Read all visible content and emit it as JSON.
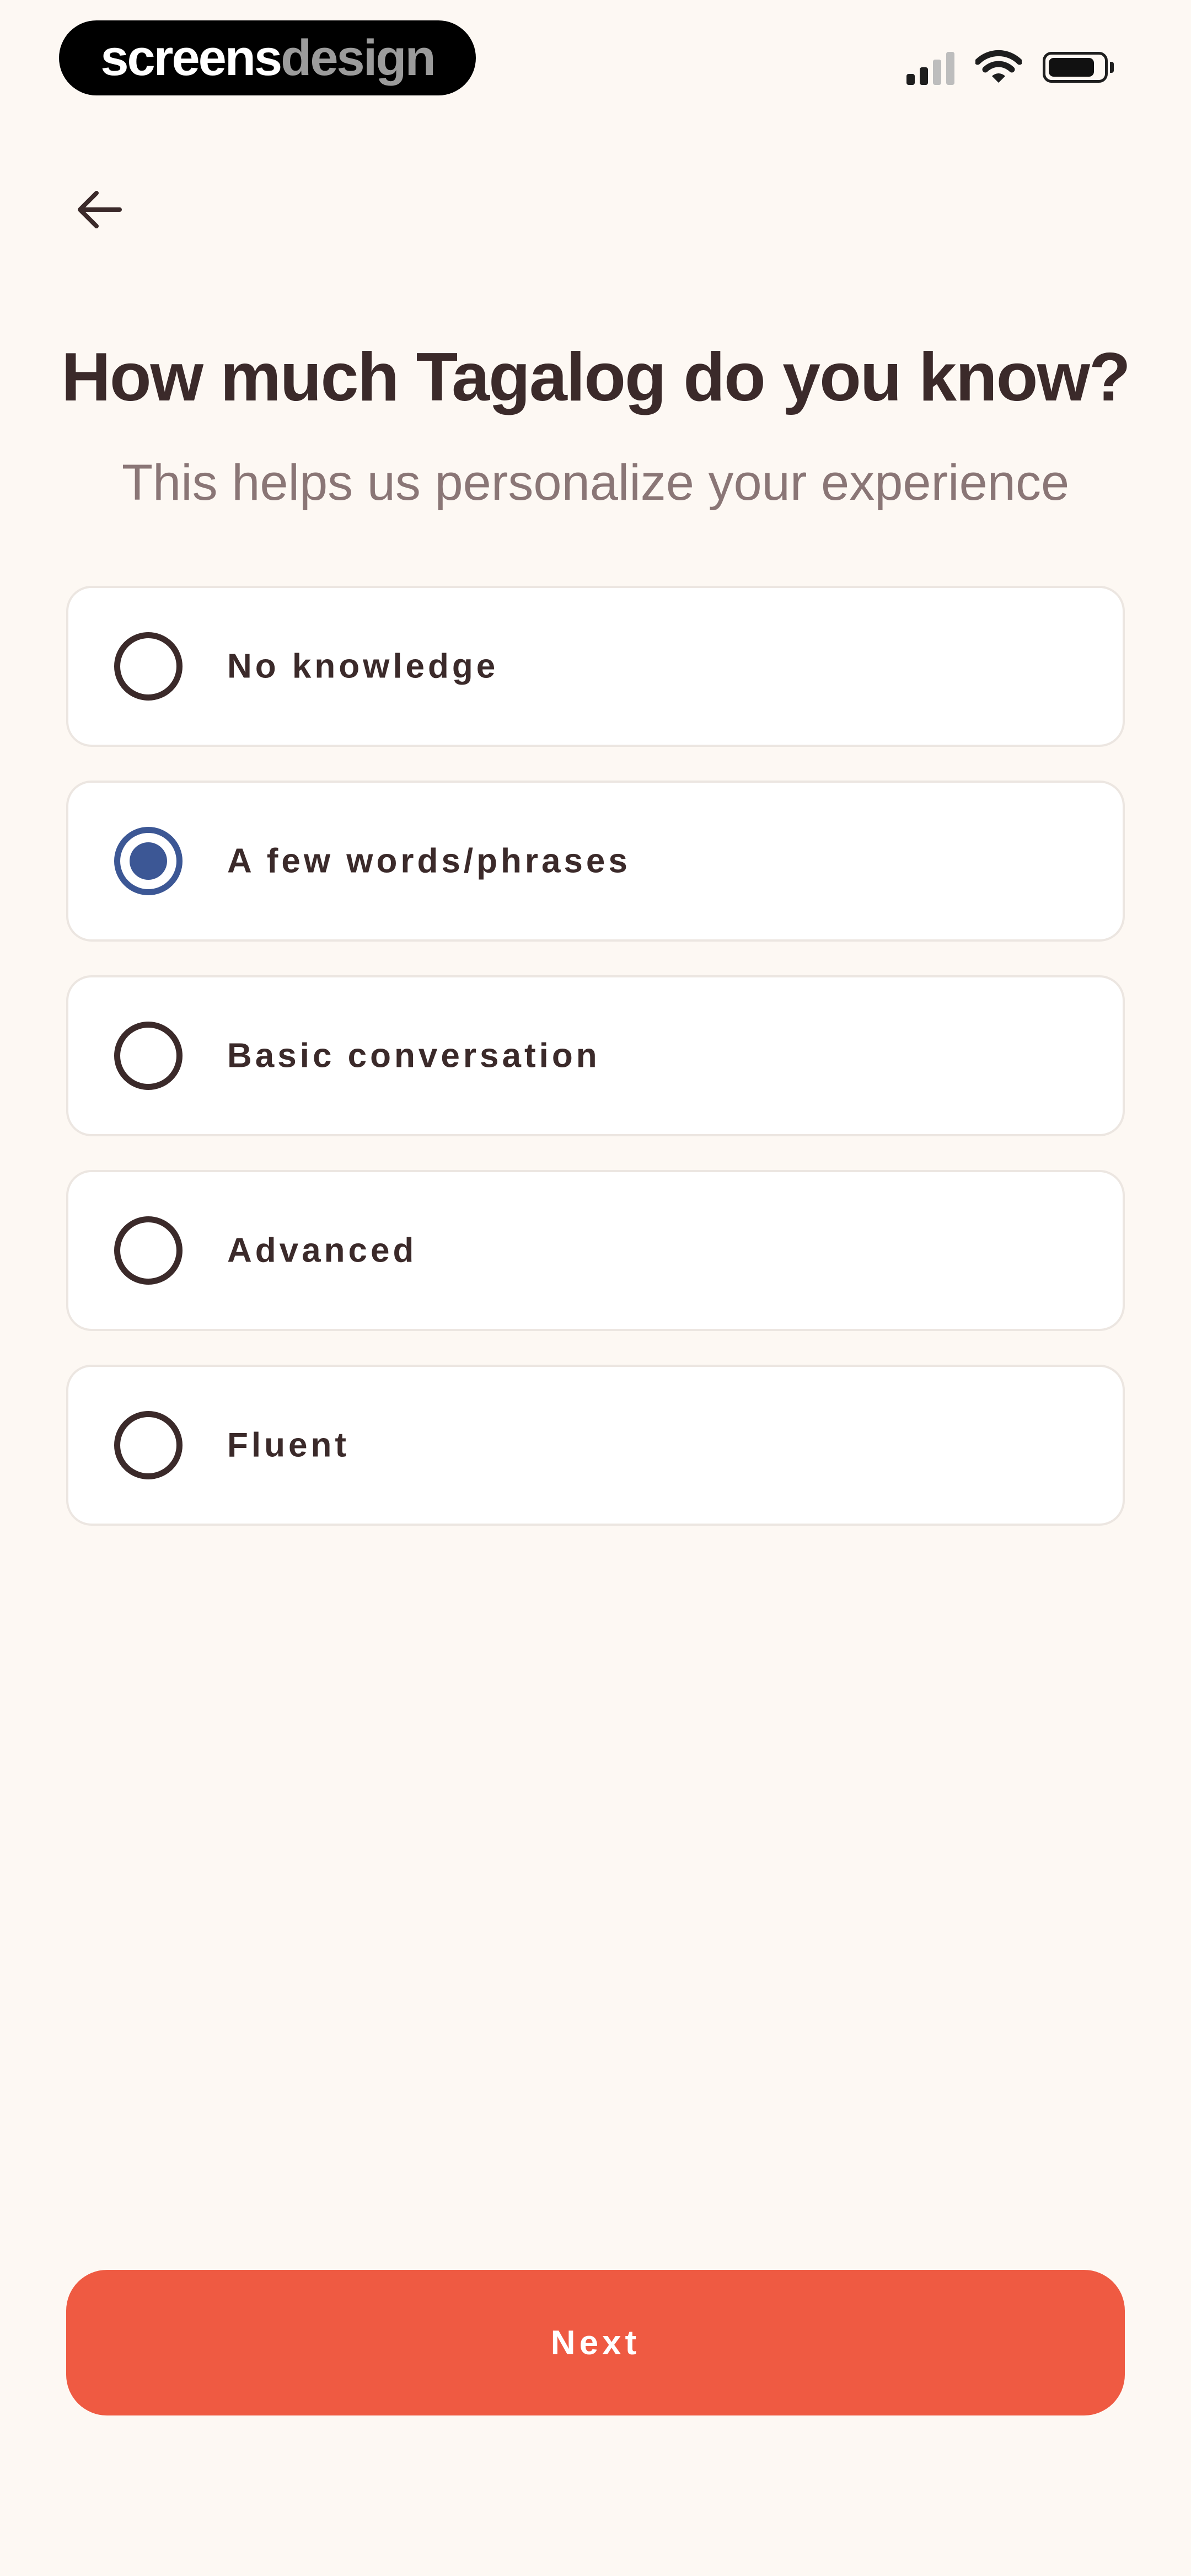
{
  "status_bar": {
    "brand_part_1": "screens",
    "brand_part_2": "design",
    "signal_icon": "cellular-signal-icon",
    "wifi_icon": "wifi-icon",
    "battery_icon": "battery-icon",
    "battery_level": 0.85
  },
  "nav": {
    "back_icon": "arrow-left-icon"
  },
  "header": {
    "title": "How much Tagalog do you know?",
    "subtitle": "This helps us personalize your experience"
  },
  "options": [
    {
      "label": "No knowledge",
      "selected": false
    },
    {
      "label": "A few words/phrases",
      "selected": true
    },
    {
      "label": "Basic conversation",
      "selected": false
    },
    {
      "label": "Advanced",
      "selected": false
    },
    {
      "label": "Fluent",
      "selected": false
    }
  ],
  "footer": {
    "next_label": "Next"
  },
  "colors": {
    "background": "#fdf8f3",
    "text_primary": "#3b2a2a",
    "text_secondary": "#8a7676",
    "selected_accent": "#3c5795",
    "cta": "#ef5a42",
    "card_border": "#ece6e1"
  }
}
